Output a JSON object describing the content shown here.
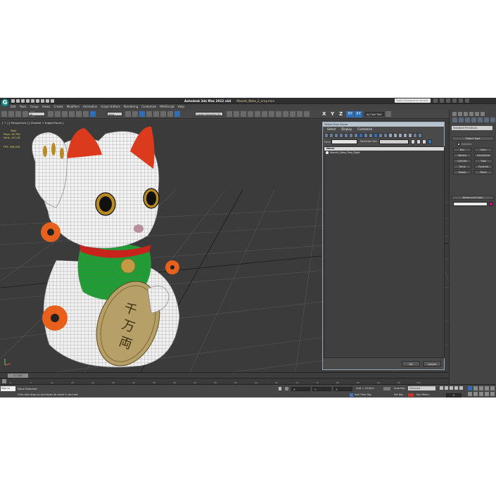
{
  "app": {
    "product": "Autodesk 3ds Max  2012 x64",
    "file": "Maneki_Neko_2_vray.max",
    "logo_glyph": "G",
    "search_placeholder": "Type a keyword or phrase",
    "menus": [
      "Edit",
      "Tools",
      "Group",
      "Views",
      "Create",
      "Modifiers",
      "Animation",
      "Graph Editors",
      "Rendering",
      "Customize",
      "MAXScript",
      "Help"
    ]
  },
  "toolbar": {
    "filter_dropdown": "All",
    "refcoord_dropdown": "View",
    "named_selection": "Create Selection Se",
    "axis_x": "X",
    "axis_y": "Y",
    "axis_z": "Z",
    "axis_xy": "XY",
    "axis_xy2": "XY",
    "cam_tool": "ay Cam Tool"
  },
  "viewport": {
    "label": "[ + ] [ Perspective ] [ Shaded + Edged Faces ]",
    "stats": {
      "total_label": "Total",
      "polys_label": "Polys:",
      "polys_value": "26 784",
      "verts_label": "Verts:",
      "verts_value": "16 118",
      "fps_label": "FPS:",
      "fps_value": "168.028"
    }
  },
  "scene_explorer": {
    "title": "Select From Scene",
    "menus": [
      "Select",
      "Display",
      "Customize"
    ],
    "find_label": "Find:",
    "selection_set_label": "Selection Set:",
    "column_header": "Name",
    "objects": [
      "Maneki_Neko_Paw_Right"
    ],
    "ok_label": "OK",
    "cancel_label": "Cancel"
  },
  "command_panel": {
    "category": "Standard Primitives",
    "object_type_title": "Object Type",
    "autogrid_label": "AutoGrid",
    "primitives": [
      "Box",
      "Cone",
      "Sphere",
      "GeoSphere",
      "Cylinder",
      "Tube",
      "Torus",
      "Pyramid",
      "Teapot",
      "Plane"
    ],
    "name_color_title": "Name and Color",
    "object_color": "#c0157a"
  },
  "timeline": {
    "slider_label": "0 / 100",
    "ticks": [
      "0",
      "5",
      "10",
      "15",
      "20",
      "25",
      "30",
      "35",
      "40",
      "45",
      "50",
      "55",
      "60",
      "65",
      "70",
      "75",
      "80",
      "85",
      "90",
      "95",
      "100"
    ]
  },
  "status": {
    "maxscript_label": "Max to",
    "selection": "None Selected",
    "prompt": "Click and drag up-and-down to zoom in and out",
    "x_label": "X:",
    "y_label": "Y:",
    "z_label": "Z:",
    "grid": "Grid = 10,0cm",
    "add_time_tag": "Add Time Tag",
    "auto_key": "Auto Key",
    "set_key": "Set Key",
    "selected_dropdown": "Selected",
    "key_filters": "Key Filters...",
    "frame_value": "0"
  },
  "colors": {
    "ui_bg": "#444444",
    "viewport_bg": "#3b3b3b",
    "accent_blue": "#2f6fb8",
    "stats_yellow": "#e6d45a"
  }
}
